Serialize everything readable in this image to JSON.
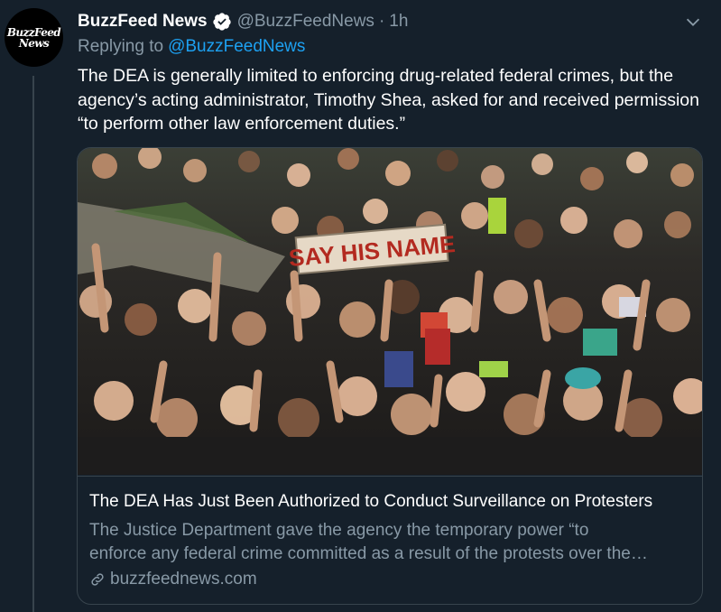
{
  "tweet": {
    "author_name": "BuzzFeed News",
    "author_handle": "@BuzzFeedNews",
    "separator": "·",
    "time": "1h",
    "avatar_text_line1": "BuzzFeed",
    "avatar_text_line2": "News",
    "replying_to_label": "Replying to",
    "replying_to_handle": "@BuzzFeedNews",
    "text": "The DEA is generally limited to enforcing drug-related federal crimes, but the agency’s acting administrator, Timothy Shea, asked for and received permission “to perform other law enforcement duties.”",
    "icons": {
      "verified": "verified-badge-icon",
      "menu": "chevron-down-icon",
      "link": "link-icon"
    },
    "accent_color": "#1da1f2",
    "muted_color": "#8899a6"
  },
  "card": {
    "photo_sign_text": "SAY HIS NAME",
    "title": "The DEA Has Just Been Authorized to Conduct Surveillance on Protesters",
    "description_line1": "The Justice Department gave the agency the temporary power “to",
    "description_line2": "enforce any federal crime committed as a result of the protests over the…",
    "domain": "buzzfeednews.com"
  }
}
